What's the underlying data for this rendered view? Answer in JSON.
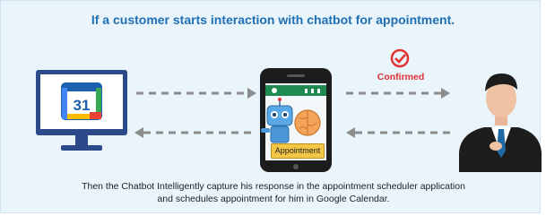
{
  "header": {
    "title": "If a customer starts interaction with chatbot for appointment."
  },
  "status": {
    "confirmed_label": "Confirmed"
  },
  "calendar": {
    "day": "31"
  },
  "phone": {
    "appointment_label": "Appointment"
  },
  "footer": {
    "line1": "Then the Chatbot Intelligently capture his response in the appointment scheduler application",
    "line2": "and schedules appointment for him in Google Calendar."
  },
  "colors": {
    "accent": "#1f6fb5",
    "confirmed": "#e23232",
    "panel": "#e9f4fb",
    "arrow": "#8c8c8c"
  },
  "icons": [
    "monitor-icon",
    "calendar-icon",
    "phone-icon",
    "robot-icon",
    "brain-icon",
    "checkmark-icon",
    "customer-icon"
  ]
}
